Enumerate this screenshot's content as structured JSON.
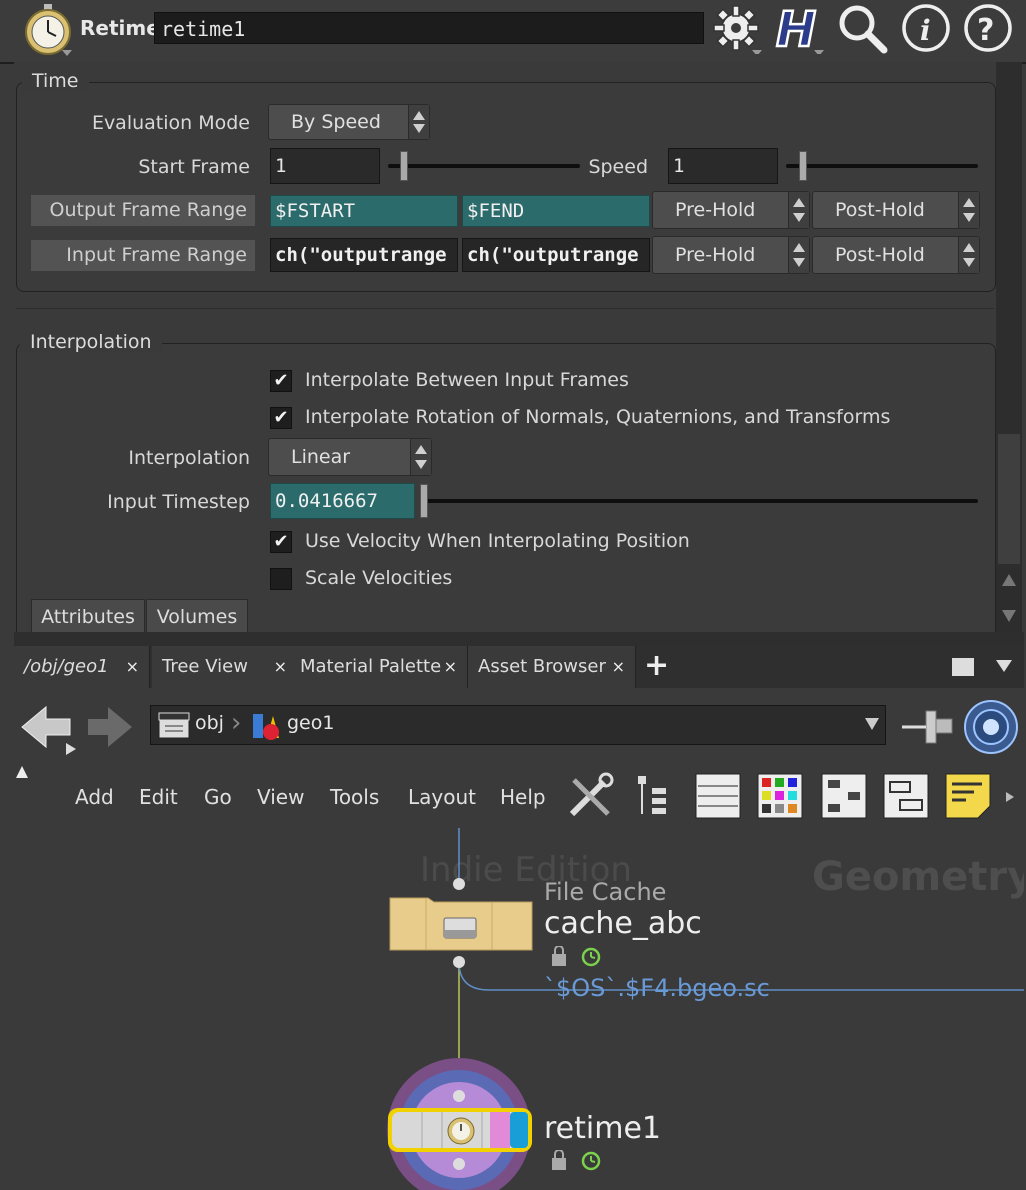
{
  "header": {
    "node_type": "Retime",
    "node_name": "retime1",
    "icons": [
      "stopwatch-icon",
      "gear-icon",
      "houdini-h-icon",
      "search-icon",
      "info-icon",
      "help-icon"
    ]
  },
  "time_group": {
    "title": "Time",
    "evaluation_mode_label": "Evaluation Mode",
    "evaluation_mode_value": "By Speed",
    "start_frame_label": "Start Frame",
    "start_frame_value": "1",
    "speed_label": "Speed",
    "speed_value": "1",
    "output_range_label": "Output Frame Range",
    "output_range_start": "$FSTART",
    "output_range_end": "$FEND",
    "output_pre": "Pre-Hold",
    "output_post": "Post-Hold",
    "input_range_label": "Input Frame Range",
    "input_range_start": "ch(\"outputrange",
    "input_range_end": "ch(\"outputrange",
    "input_pre": "Pre-Hold",
    "input_post": "Post-Hold"
  },
  "interp_group": {
    "title": "Interpolation",
    "interp_between_label": "Interpolate Between Input Frames",
    "interp_between_checked": true,
    "interp_rotation_label": "Interpolate Rotation of Normals, Quaternions, and Transforms",
    "interp_rotation_checked": true,
    "interpolation_label": "Interpolation",
    "interpolation_value": "Linear",
    "timestep_label": "Input Timestep",
    "timestep_value": "0.0416667",
    "use_velocity_label": "Use Velocity When Interpolating Position",
    "use_velocity_checked": true,
    "scale_velocities_label": "Scale Velocities",
    "scale_velocities_checked": false,
    "check_glyph": "✔"
  },
  "bottom_tabs": [
    "Attributes",
    "Volumes"
  ],
  "pane_tabs": [
    {
      "label": "/obj/geo1",
      "close": "×"
    },
    {
      "label": "Tree View",
      "close": "×"
    },
    {
      "label": "Material Palette",
      "close": "×"
    },
    {
      "label": "Asset Browser",
      "close": "×"
    }
  ],
  "add_tab": "+",
  "path": {
    "segments": [
      "obj",
      "geo1"
    ]
  },
  "menu": [
    "Add",
    "Edit",
    "Go",
    "View",
    "Tools",
    "Layout",
    "Help"
  ],
  "network": {
    "watermark_left": "Indie Edition",
    "watermark_right": "Geometry",
    "file_cache_type": "File Cache",
    "file_cache_name": "cache_abc",
    "file_cache_path": "`$OS`.$F4.bgeo.sc",
    "retime_name": "retime1"
  },
  "colors": {
    "teal_field": "#2c6b6b",
    "selected_node_outline": "#f2d100",
    "wire": "#5f8fc8",
    "file_cache_node": "#e8cc8c"
  }
}
